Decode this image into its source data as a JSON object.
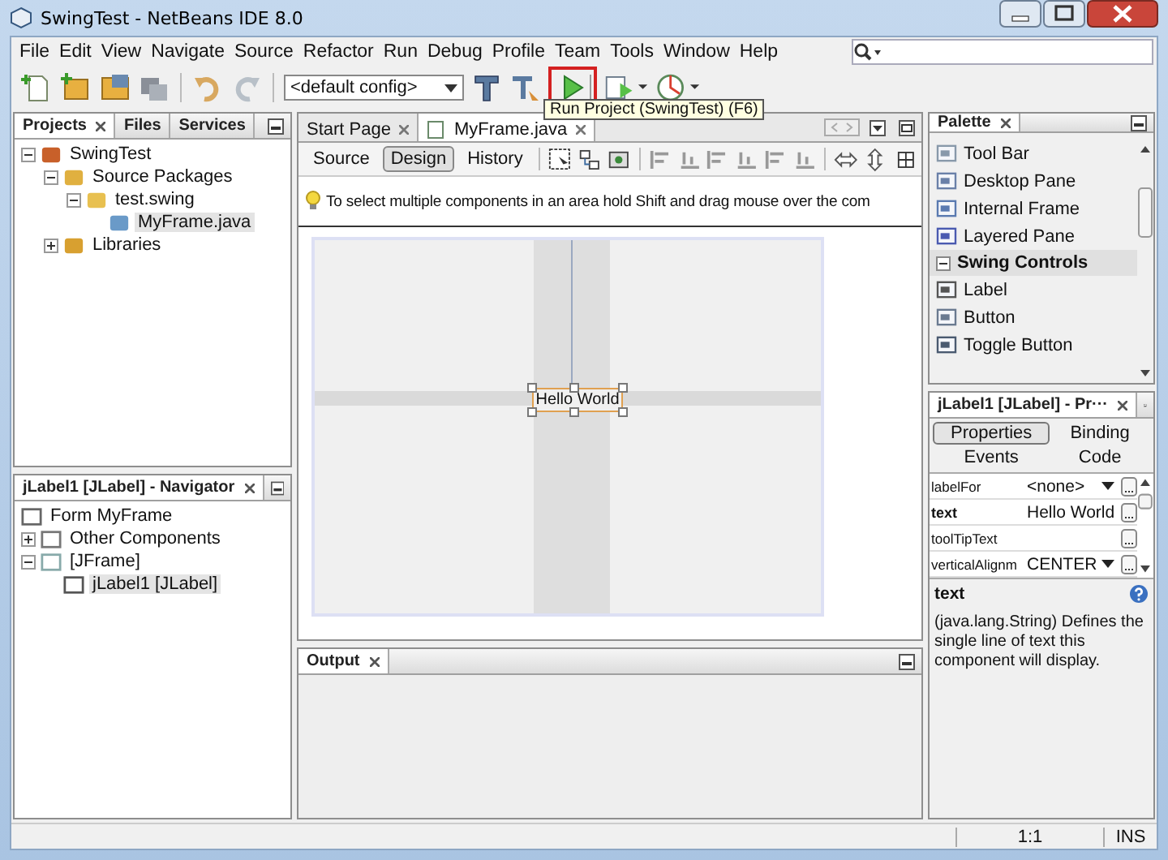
{
  "window": {
    "title": "SwingTest - NetBeans IDE 8.0"
  },
  "menu": [
    "File",
    "Edit",
    "View",
    "Navigate",
    "Source",
    "Refactor",
    "Run",
    "Debug",
    "Profile",
    "Team",
    "Tools",
    "Window",
    "Help"
  ],
  "toolbar": {
    "config": "<default config>",
    "tooltip": "Run Project (SwingTest) (F6)"
  },
  "projects": {
    "tabs": [
      {
        "label": "Projects",
        "selected": true
      },
      {
        "label": "Files",
        "selected": false
      },
      {
        "label": "Services",
        "selected": false
      }
    ],
    "tree": [
      {
        "label": "SwingTest",
        "kind": "project",
        "expanded": true,
        "selected": false,
        "children": [
          {
            "label": "Source Packages",
            "kind": "folder",
            "expanded": true,
            "selected": false,
            "children": [
              {
                "label": "test.swing",
                "kind": "package",
                "expanded": true,
                "selected": false,
                "children": [
                  {
                    "label": "MyFrame.java",
                    "kind": "form",
                    "selected": true
                  }
                ]
              }
            ]
          },
          {
            "label": "Libraries",
            "kind": "library",
            "expanded": false,
            "selected": false
          }
        ]
      }
    ]
  },
  "navigator": {
    "title": "jLabel1 [JLabel] - Navigator",
    "tree": [
      {
        "label": "Form MyFrame",
        "kind": "form-root",
        "selected": false
      },
      {
        "label": "Other Components",
        "kind": "components",
        "expanded": false,
        "selected": false
      },
      {
        "label": "[JFrame]",
        "kind": "frame",
        "expanded": true,
        "selected": false,
        "children": [
          {
            "label": "jLabel1 [JLabel]",
            "kind": "label",
            "selected": true
          }
        ]
      }
    ]
  },
  "editor": {
    "tabs": [
      {
        "label": "Start Page",
        "selected": false
      },
      {
        "label": "MyFrame.java",
        "selected": true
      }
    ],
    "views": [
      {
        "label": "Source",
        "selected": false
      },
      {
        "label": "Design",
        "selected": true
      },
      {
        "label": "History",
        "selected": false
      }
    ],
    "hint": "To select multiple components in an area hold Shift and drag mouse over the com",
    "label_text": "Hello World"
  },
  "palette": {
    "title": "Palette",
    "items": [
      {
        "label": "Tool Bar",
        "kind": "toolbar"
      },
      {
        "label": "Desktop Pane",
        "kind": "desktop"
      },
      {
        "label": "Internal Frame",
        "kind": "frame"
      },
      {
        "label": "Layered Pane",
        "kind": "layered"
      },
      {
        "label": "Swing Controls",
        "kind": "category"
      },
      {
        "label": "Label",
        "kind": "label"
      },
      {
        "label": "Button",
        "kind": "button"
      },
      {
        "label": "Toggle Button",
        "kind": "toggle"
      }
    ]
  },
  "properties": {
    "title": "jLabel1 [JLabel] - Pr···",
    "tabs": [
      {
        "label": "Properties",
        "selected": true
      },
      {
        "label": "Binding",
        "selected": false
      },
      {
        "label": "Events",
        "selected": false
      },
      {
        "label": "Code",
        "selected": false
      }
    ],
    "rows": [
      {
        "name": "labelFor",
        "value": "<none>",
        "changed": false,
        "kind": "combo"
      },
      {
        "name": "text",
        "value": "Hello World",
        "changed": true,
        "kind": "text"
      },
      {
        "name": "toolTipText",
        "changed": false,
        "kind": "text"
      },
      {
        "name": "verticalAlignm",
        "value": "CENTER",
        "changed": false,
        "kind": "combo"
      }
    ],
    "help_title": "text",
    "help_text": "(java.lang.String) Defines the single line of text this component will display."
  },
  "output": {
    "title": "Output"
  },
  "status_bar": {
    "position": "1:1",
    "mode": "INS"
  }
}
